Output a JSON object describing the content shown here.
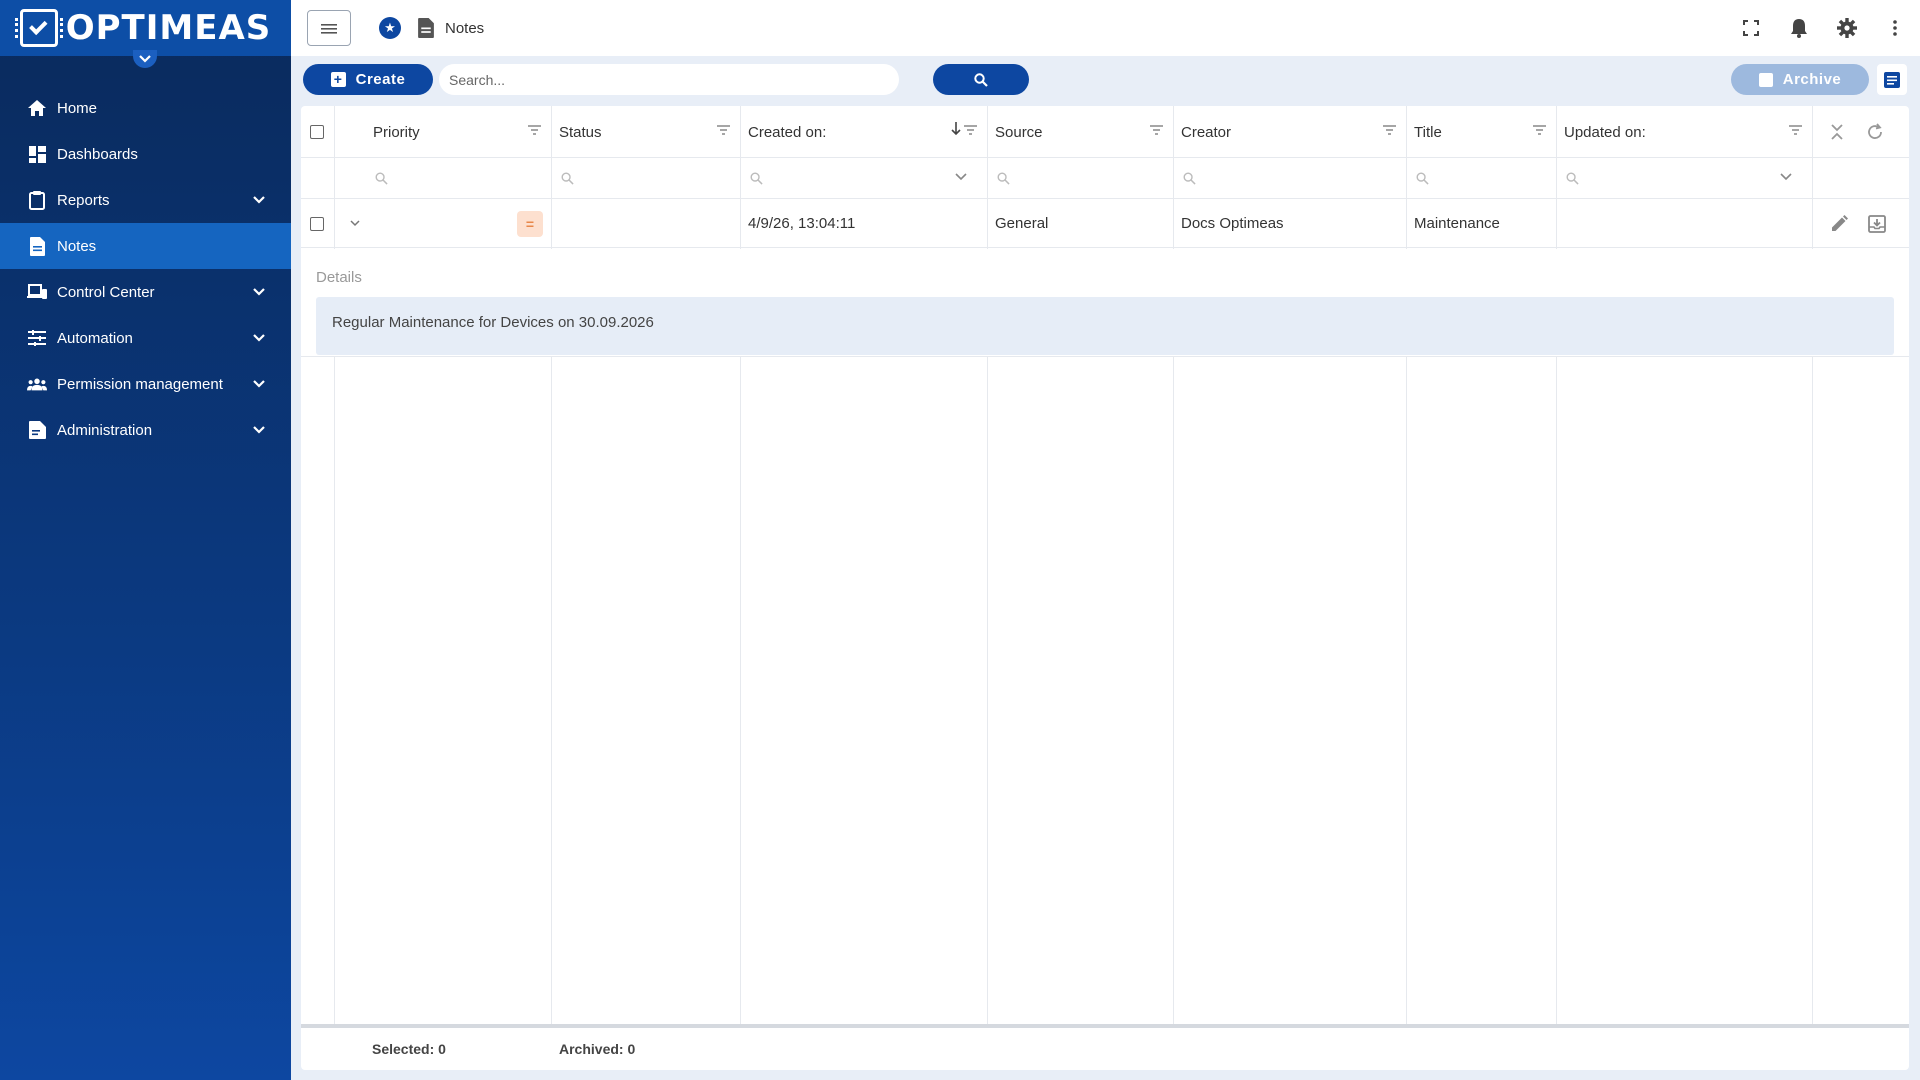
{
  "app": {
    "brand": "OPTIMEAS"
  },
  "sidebar": {
    "items": [
      {
        "label": "Home",
        "icon": "home-icon",
        "expandable": false,
        "active": false
      },
      {
        "label": "Dashboards",
        "icon": "dashboard-icon",
        "expandable": false,
        "active": false
      },
      {
        "label": "Reports",
        "icon": "clipboard-icon",
        "expandable": true,
        "active": false
      },
      {
        "label": "Notes",
        "icon": "document-icon",
        "expandable": false,
        "active": true
      },
      {
        "label": "Control Center",
        "icon": "devices-icon",
        "expandable": true,
        "active": false
      },
      {
        "label": "Automation",
        "icon": "sliders-icon",
        "expandable": true,
        "active": false
      },
      {
        "label": "Permission management",
        "icon": "users-icon",
        "expandable": true,
        "active": false
      },
      {
        "label": "Administration",
        "icon": "admin-document-icon",
        "expandable": true,
        "active": false
      }
    ]
  },
  "header": {
    "breadcrumb": "Notes"
  },
  "toolbar": {
    "create_label": "Create",
    "search_placeholder": "Search...",
    "search_value": "",
    "archive_label": "Archive"
  },
  "table": {
    "columns": {
      "priority": "Priority",
      "status": "Status",
      "created_on": "Created on:",
      "source": "Source",
      "creator": "Creator",
      "title": "Title",
      "updated_on": "Updated on:"
    },
    "rows": [
      {
        "priority": "=",
        "status": "",
        "created_on": "4/9/26, 13:04:11",
        "source": "General",
        "creator": "Docs Optimeas",
        "title": "Maintenance",
        "updated_on": ""
      }
    ],
    "details_label": "Details",
    "details_text": "Regular Maintenance for Devices on 30.09.2026"
  },
  "footer": {
    "selected": "Selected: 0",
    "archived": "Archived: 0"
  },
  "colors": {
    "primary": "#0d47a1",
    "sidebar": "#0b3a82",
    "priority_medium": "#fde0cf"
  }
}
